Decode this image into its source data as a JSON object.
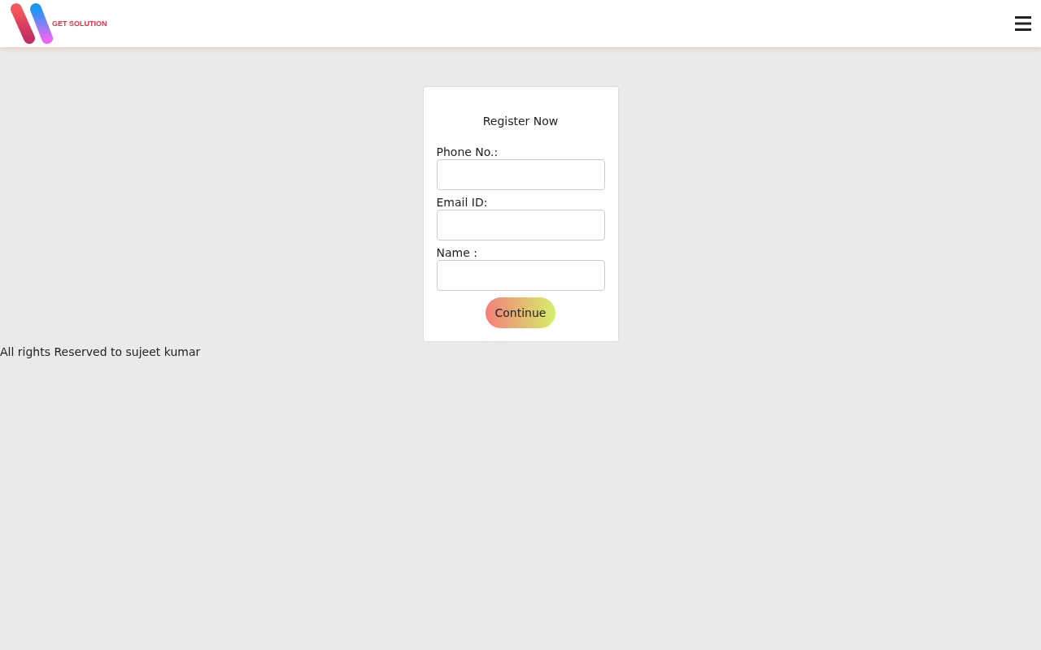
{
  "header": {
    "logo_text": "GET SOLUTION"
  },
  "form": {
    "title": "Register Now",
    "fields": [
      {
        "label": "Phone No.:"
      },
      {
        "label": "Email ID:"
      },
      {
        "label": "Name :"
      }
    ],
    "button": "Continue"
  },
  "footer": "All rights Reserved to sujeet kumar"
}
